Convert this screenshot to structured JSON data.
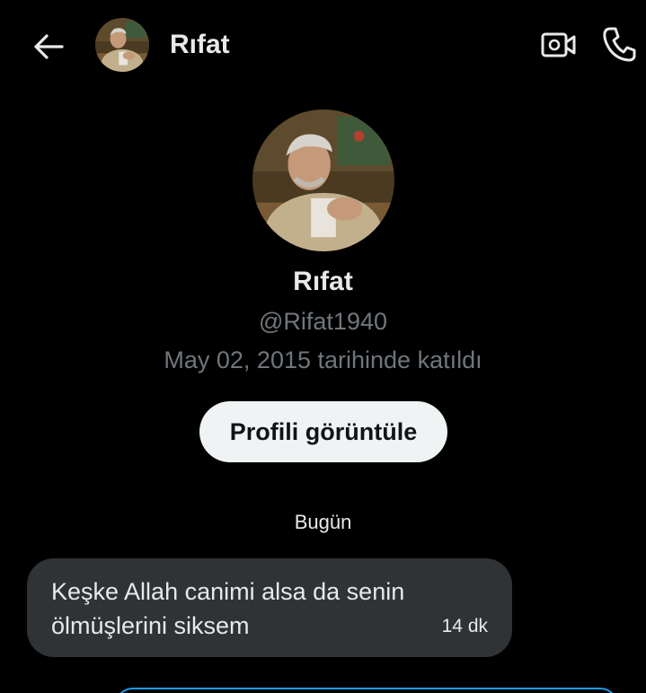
{
  "header": {
    "back_icon": "arrow-left-icon",
    "title": "Rıfat",
    "video_icon": "video-call-icon",
    "call_icon": "phone-icon"
  },
  "profile": {
    "name": "Rıfat",
    "handle": "@Rifat1940",
    "joined": "May 02, 2015 tarihinde katıldı",
    "view_profile_label": "Profili görüntüle"
  },
  "conversation": {
    "day_label": "Bugün",
    "messages": [
      {
        "text": "Keşke Allah canimi alsa da senin ölmüşlerini siksem",
        "time": "14 dk"
      }
    ]
  },
  "colors": {
    "background": "#000000",
    "primary_text": "#e7e9ea",
    "secondary_text": "#71767b",
    "bubble": "#2f3336",
    "button_bg": "#eff3f4",
    "accent": "#1d9bf0"
  }
}
